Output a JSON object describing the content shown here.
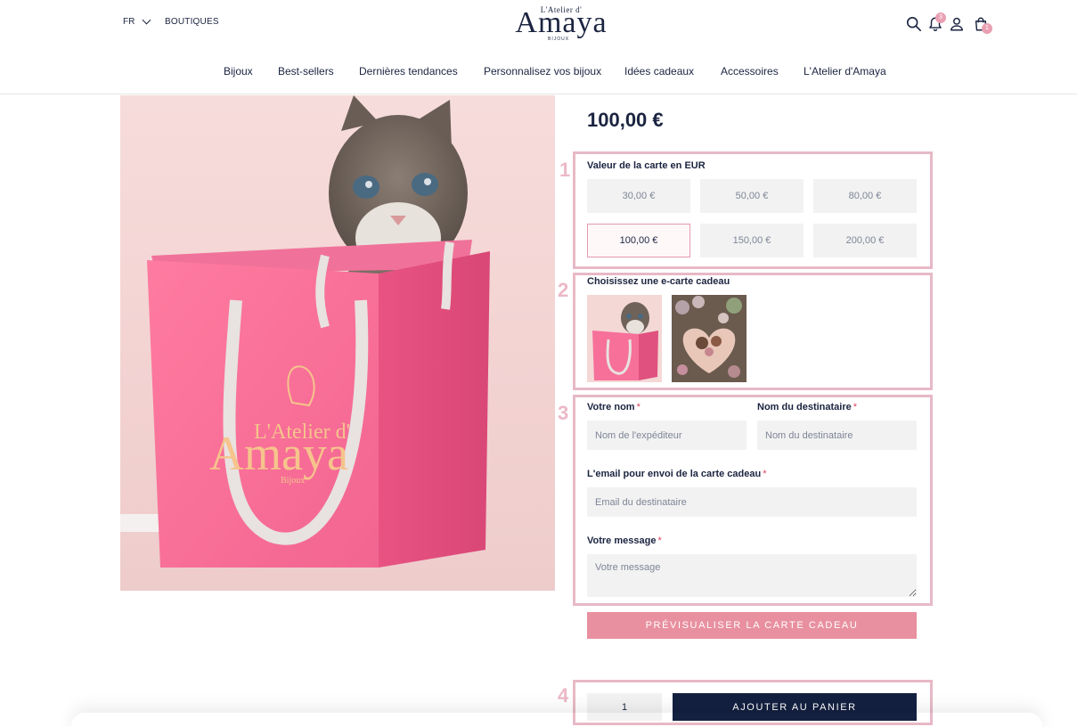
{
  "header": {
    "language": "FR",
    "boutiques": "BOUTIQUES",
    "logo": {
      "top_line": "L'Atelier d'",
      "name": "Amaya",
      "sub": "BIJOUX"
    },
    "notifications_count": "3",
    "cart_count": "1",
    "icons": [
      "search-icon",
      "bell-icon",
      "user-icon",
      "bag-icon"
    ]
  },
  "nav": {
    "items": [
      "Bijoux",
      "Best-sellers",
      "Dernières tendances",
      "Personnalisez vos bijoux",
      "Idées cadeaux",
      "Accessoires",
      "L'Atelier d'Amaya"
    ]
  },
  "product": {
    "price": "100,00 €",
    "bag_logo": {
      "top_line": "L'Atelier d'",
      "name": "Amaya",
      "sub": "Bijoux"
    }
  },
  "steps": [
    "1",
    "2",
    "3",
    "4"
  ],
  "amount_section": {
    "label": "Valeur de la carte en EUR",
    "options": [
      "30,00 €",
      "50,00 €",
      "80,00 €",
      "100,00 €",
      "150,00 €",
      "200,00 €"
    ],
    "selected": "100,00 €"
  },
  "ecard_section": {
    "label": "Choisissez une e-carte cadeau",
    "thumbnails": [
      "kitten-bag",
      "flowers-heart-hands"
    ]
  },
  "form": {
    "sender_label": "Votre nom",
    "sender_placeholder": "Nom de l'expéditeur",
    "recipient_label": "Nom du destinataire",
    "recipient_placeholder": "Nom du destinataire",
    "email_label": "L'email pour envoi de la carte cadeau",
    "email_placeholder": "Email du destinataire",
    "message_label": "Votre message",
    "message_placeholder": "Votre message",
    "required_mark": "*"
  },
  "preview_button": "PRÉVISUALISER LA CARTE CADEAU",
  "purchase": {
    "quantity": "1",
    "add_to_cart": "AJOUTER AU PANIER"
  },
  "colors": {
    "navy": "#142040",
    "pink_accent": "#e8909f",
    "step_pink": "#ecb8c7",
    "field_bg": "#f2f2f2"
  }
}
